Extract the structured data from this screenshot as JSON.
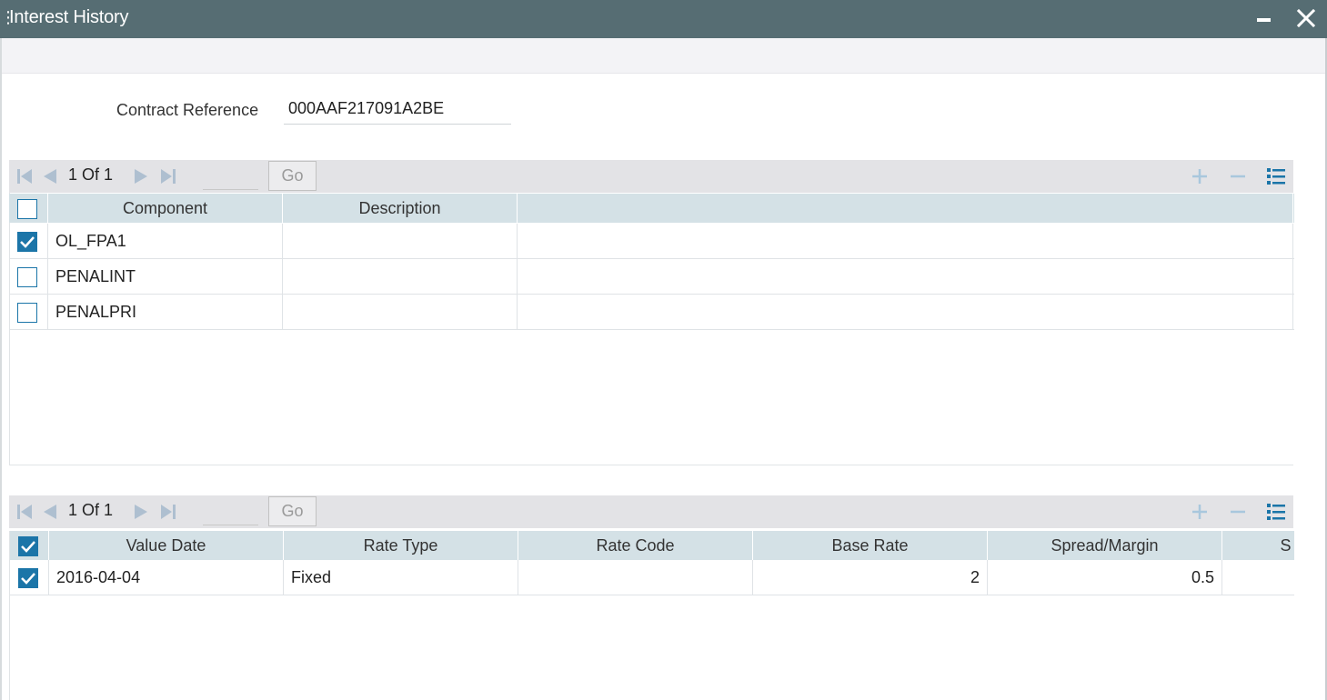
{
  "window": {
    "title": "Interest History"
  },
  "form": {
    "contract_reference_label": "Contract Reference",
    "contract_reference_value": "000AAF217091A2BE"
  },
  "components_grid": {
    "pager": {
      "current": "1",
      "of_label": "Of",
      "total": "1",
      "page_text": "1 Of 1",
      "go_label": "Go"
    },
    "columns": [
      "Component",
      "Description"
    ],
    "header_checkbox_checked": false,
    "rows": [
      {
        "component": "OL_FPA1",
        "description": "",
        "checked": true
      },
      {
        "component": "PENALINT",
        "description": "",
        "checked": false
      },
      {
        "component": "PENALPRI",
        "description": "",
        "checked": false
      }
    ]
  },
  "rates_grid": {
    "pager": {
      "page_text": "1 Of 1",
      "go_label": "Go"
    },
    "columns": [
      "Value Date",
      "Rate Type",
      "Rate Code",
      "Base Rate",
      "Spread/Margin",
      "S"
    ],
    "header_checkbox_checked": true,
    "rows": [
      {
        "value_date": "2016-04-04",
        "rate_type": "Fixed",
        "rate_code": "",
        "base_rate": "2",
        "spread_margin": "0.5",
        "checked": true
      }
    ]
  },
  "icons": {
    "accent": "#1b75a8",
    "nav_disabled": "#aebfd0",
    "tool_disabled": "#a9c7dd",
    "list_view": "#1b75a8"
  }
}
